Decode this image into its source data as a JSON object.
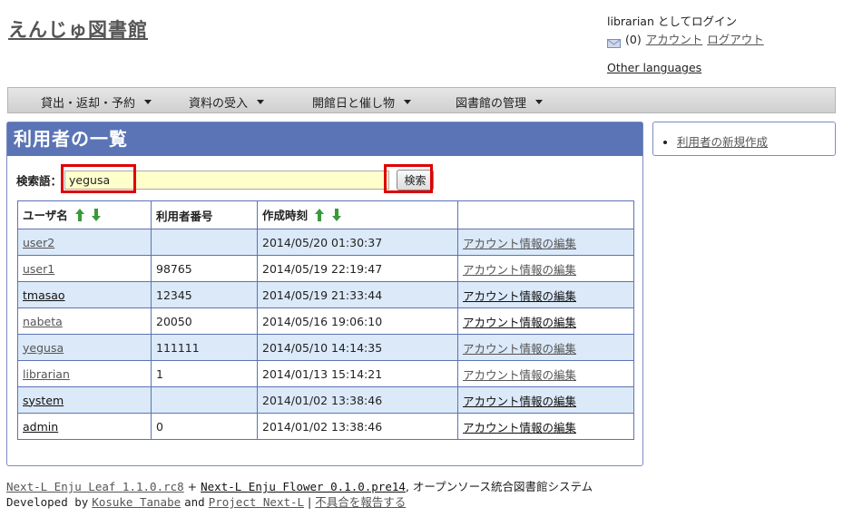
{
  "header": {
    "site_title": "えんじゅ図書館",
    "login_text": "librarian としてログイン",
    "message_count": "(0)",
    "account_link": "アカウント",
    "logout_link": "ログアウト",
    "other_languages": "Other languages"
  },
  "menu": [
    {
      "label": "貸出・返却・予約"
    },
    {
      "label": "資料の受入"
    },
    {
      "label": "開館日と催し物"
    },
    {
      "label": "図書館の管理"
    }
  ],
  "main": {
    "title": "利用者の一覧",
    "search_label": "検索語：",
    "search_value": "yegusa",
    "search_button": "検索",
    "columns": [
      "ユーザ名",
      "利用者番号",
      "作成時刻",
      ""
    ],
    "rows": [
      {
        "username": "user2",
        "number": "",
        "created": "2014/05/20 01:30:37",
        "action": "アカウント情報の編集"
      },
      {
        "username": "user1",
        "number": "98765",
        "created": "2014/05/19 22:19:47",
        "action": "アカウント情報の編集"
      },
      {
        "username": "tmasao",
        "number": "12345",
        "created": "2014/05/19 21:33:44",
        "action": "アカウント情報の編集"
      },
      {
        "username": "nabeta",
        "number": "20050",
        "created": "2014/05/16 19:06:10",
        "action": "アカウント情報の編集"
      },
      {
        "username": "yegusa",
        "number": "111111",
        "created": "2014/05/10 14:14:35",
        "action": "アカウント情報の編集"
      },
      {
        "username": "librarian",
        "number": "1",
        "created": "2014/01/13 15:14:21",
        "action": "アカウント情報の編集"
      },
      {
        "username": "system",
        "number": "",
        "created": "2014/01/02 13:38:46",
        "action": "アカウント情報の編集"
      },
      {
        "username": "admin",
        "number": "0",
        "created": "2014/01/02 13:38:46",
        "action": "アカウント情報の編集"
      }
    ]
  },
  "sidebar": {
    "new_user_link": "利用者の新規作成"
  },
  "footer": {
    "leaf_link": "Next-L Enju Leaf 1.1.0.rc8",
    "plus": "+",
    "flower_link": "Next-L Enju Flower 0.1.0.pre14",
    "system_text": ", オープンソース統合図書館システム",
    "developed_by": "Developed by",
    "author_link": "Kosuke Tanabe",
    "and_text": "and",
    "project_link": "Project Next-L",
    "separator": "|",
    "report_link": "不具合を報告する"
  },
  "colors": {
    "panel_header": "#5a74b5",
    "row_alt": "#dbe9f8",
    "search_bg": "#ffffcc",
    "highlight": "#e00000",
    "sort_arrow": "#3a9a3a"
  }
}
